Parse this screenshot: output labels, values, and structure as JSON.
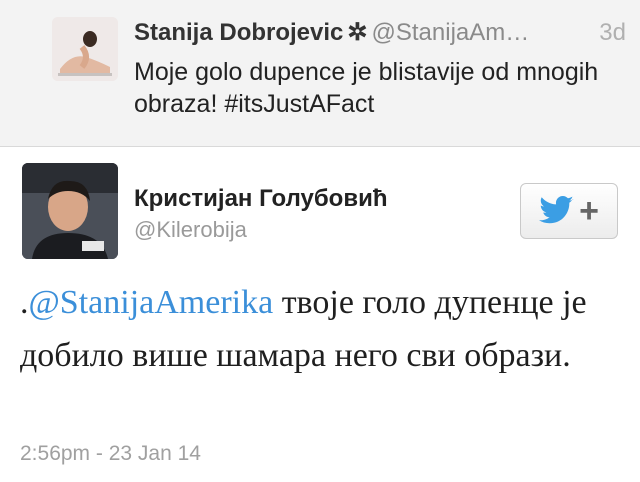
{
  "quoted_tweet": {
    "author_name": "Stanija Dobrojevic",
    "verified_glyph": "✲",
    "handle": "@StanijaAm…",
    "time": "3d",
    "text": "Moje golo dupence je blistavije od mnogih obraza! #itsJustAFact",
    "avatar": "user-avatar-photo"
  },
  "tweet": {
    "author_name": "Кристијан Голубовић",
    "handle": "@Kilerobija",
    "avatar": "user-avatar-photo",
    "text_prefix": ".",
    "mention": "@StanijaAmerika",
    "text_rest": " твоје голо дупенце је добило више шамара него сви образи.",
    "timestamp": "2:56pm - 23 Jan 14"
  },
  "follow_button": {
    "icon": "twitter-bird-icon",
    "plus": "+"
  },
  "colors": {
    "mention": "#3b8fd9",
    "twitter_bird": "#3b9ee4",
    "quoted_background": "#f3f3f3"
  }
}
